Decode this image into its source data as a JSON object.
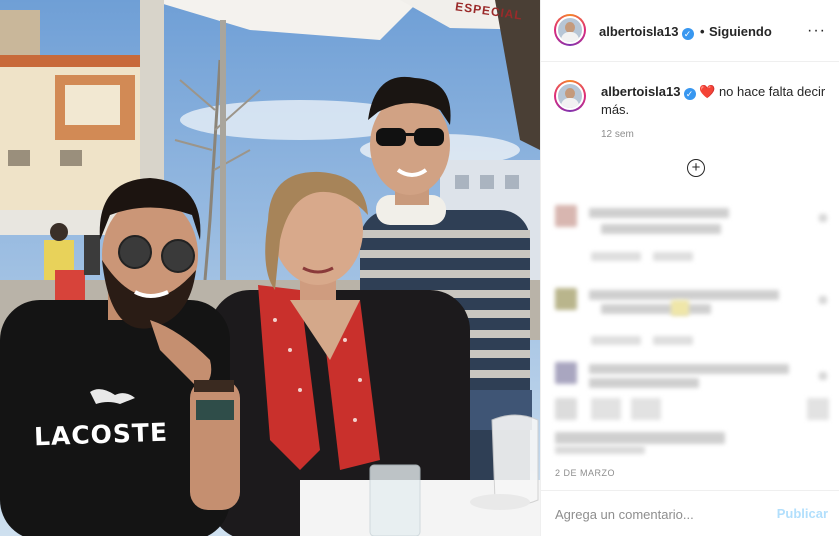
{
  "post": {
    "username": "albertoisla13",
    "follow_status": "Siguiendo",
    "follow_separator": "•",
    "verified_icon": "verified-badge-icon",
    "more_icon": "more-options-icon",
    "more_glyph": "···"
  },
  "caption": {
    "username": "albertoisla13",
    "heart": "❤️",
    "text": "no hace falta decir más.",
    "time_ago": "12 sem"
  },
  "load_more": {
    "icon": "plus-circle-icon",
    "glyph": "+"
  },
  "photo": {
    "sweater_text": "LACOSTE",
    "sign_text": "ESPECIAL"
  },
  "footer": {
    "date": "2 DE MARZO"
  },
  "comment_box": {
    "placeholder": "Agrega un comentario...",
    "publish_label": "Publicar"
  },
  "colors": {
    "accent_blue": "#3897f0",
    "publish_disabled": "#b2dffc",
    "heart_red": "#e0245e",
    "muted_text": "#8e8e8e"
  }
}
